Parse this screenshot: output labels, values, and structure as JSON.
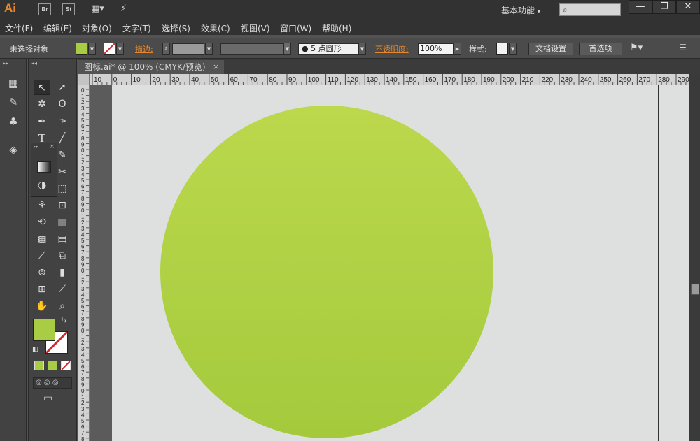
{
  "app": {
    "logo": "Ai",
    "bridge": "Br",
    "stock": "St",
    "workspace": "基本功能",
    "window_min": "—",
    "window_restore": "❐",
    "window_close": "✕"
  },
  "menu": {
    "items": [
      "文件(F)",
      "编辑(E)",
      "对象(O)",
      "文字(T)",
      "选择(S)",
      "效果(C)",
      "视图(V)",
      "窗口(W)",
      "帮助(H)"
    ]
  },
  "control": {
    "selection_status": "未选择对象",
    "fill_color": "#a8cc44",
    "stroke_label": "描边:",
    "brush_label": "5 点圆形",
    "opacity_label": "不透明度:",
    "opacity_value": "100%",
    "style_label": "样式:",
    "doc_setup": "文档设置",
    "preferences": "首选项"
  },
  "document": {
    "tab_title": "图标.ai* @ 100% (CMYK/预览)",
    "tab_close": "×"
  },
  "ruler": {
    "h_labels": [
      "10",
      "0",
      "10",
      "20",
      "30",
      "40",
      "50",
      "60",
      "70",
      "80",
      "90",
      "100",
      "110",
      "120",
      "130",
      "140",
      "150",
      "160",
      "170",
      "180",
      "190",
      "200",
      "210",
      "220",
      "230",
      "240",
      "250",
      "260",
      "270",
      "280",
      "290"
    ],
    "v_labels": [
      "0",
      "1",
      "2",
      "3",
      "4",
      "5",
      "6",
      "7",
      "8",
      "9",
      "0",
      "1",
      "2",
      "3",
      "4",
      "5",
      "6",
      "7",
      "8",
      "9",
      "0",
      "1",
      "2",
      "3",
      "4",
      "5",
      "6",
      "7",
      "8",
      "9",
      "0",
      "1",
      "2",
      "3",
      "4",
      "5",
      "6",
      "7",
      "8",
      "9",
      "0",
      "1",
      "2",
      "3",
      "4",
      "5",
      "6",
      "7",
      "8",
      "9",
      "0",
      "1",
      "2",
      "3",
      "4",
      "5",
      "6",
      "7",
      "8",
      "9"
    ]
  },
  "artwork": {
    "circle_color_top": "#bcd84d",
    "circle_color_bottom": "#a4ca3c"
  },
  "colors": {
    "accent": "#e8882d",
    "artboard": "#dde0de",
    "panel": "#424242"
  }
}
